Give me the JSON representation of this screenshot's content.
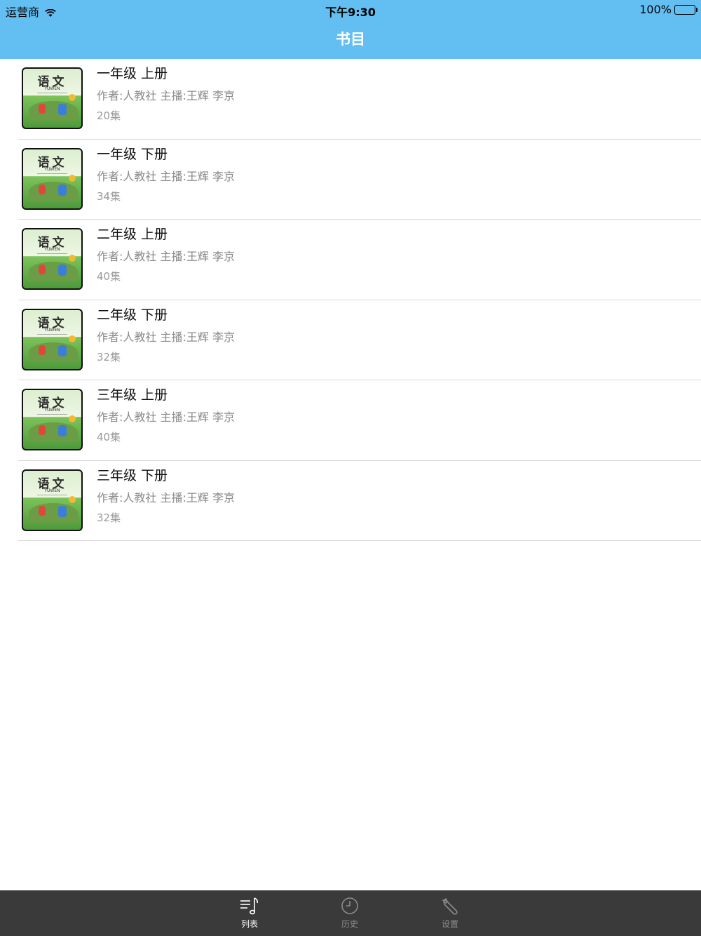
{
  "status_bar": {
    "carrier": "运营商",
    "time": "下午9:30",
    "battery": "100%"
  },
  "nav": {
    "title": "书目"
  },
  "books": [
    {
      "title": "一年级 上册",
      "meta": "作者:人教社  主播:王辉 李京",
      "episodes": "20集"
    },
    {
      "title": "一年级 下册",
      "meta": "作者:人教社  主播:王辉 李京",
      "episodes": "34集"
    },
    {
      "title": "二年级 上册",
      "meta": "作者:人教社  主播:王辉 李京",
      "episodes": "40集"
    },
    {
      "title": "二年级 下册",
      "meta": "作者:人教社  主播:王辉 李京",
      "episodes": "32集"
    },
    {
      "title": "三年级 上册",
      "meta": "作者:人教社  主播:王辉 李京",
      "episodes": "40集"
    },
    {
      "title": "三年级 下册",
      "meta": "作者:人教社  主播:王辉 李京",
      "episodes": "32集"
    }
  ],
  "cover": {
    "caption": "语文",
    "sub": "YUWEN"
  },
  "tabs": [
    {
      "label": "列表",
      "icon": "music-list-icon",
      "active": true
    },
    {
      "label": "历史",
      "icon": "clock-icon",
      "active": false
    },
    {
      "label": "设置",
      "icon": "wrench-icon",
      "active": false
    }
  ],
  "colors": {
    "nav_bg": "#63bef1",
    "tab_bg": "#3a3a3a"
  }
}
